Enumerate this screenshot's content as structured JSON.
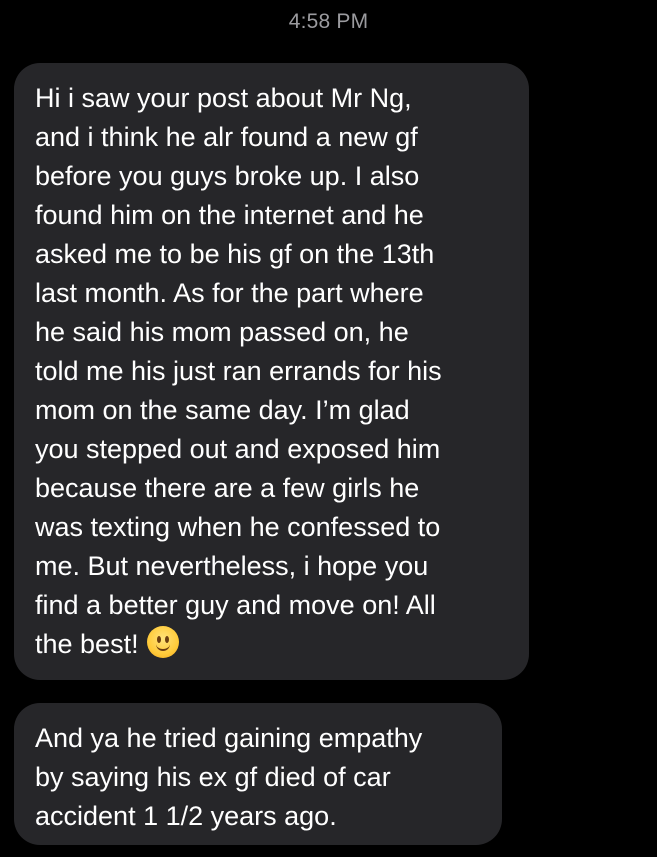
{
  "conversation": {
    "timestamp": "4:58 PM",
    "messages": [
      {
        "lines": [
          "Hi i saw your post about Mr Ng,",
          "and i think he alr found a new gf",
          "before you guys broke up. I also",
          "found him on the internet and he",
          "asked me to be his gf on the 13th",
          "last month. As for the part where",
          "he said his mom passed on, he",
          "told me his just ran errands for his",
          "mom on the same day. I’m glad",
          "you stepped out and exposed him",
          "because there are a few girls he",
          "was texting when he confessed to",
          "me. But nevertheless, i hope you",
          "find a better guy and move on! All",
          "the best!"
        ],
        "emoji": "slightly-smiling-face"
      },
      {
        "lines": [
          "And ya he tried gaining empathy",
          "by saying his ex gf died of car",
          "accident 1 1/2 years ago."
        ]
      }
    ]
  },
  "colors": {
    "background": "#000000",
    "bubble": "#262629",
    "text": "#ffffff",
    "timestamp": "#9b9b9f"
  }
}
